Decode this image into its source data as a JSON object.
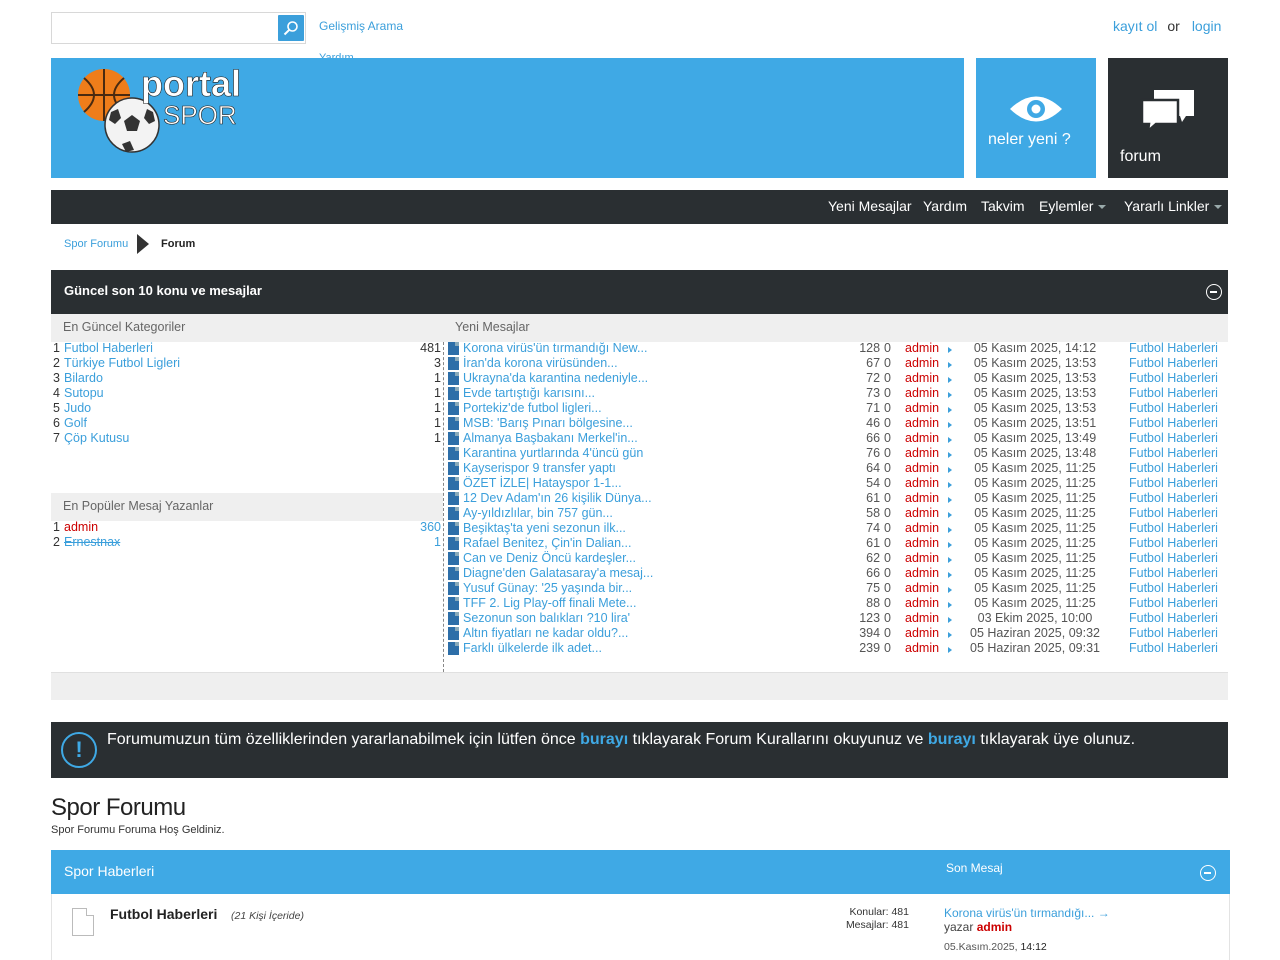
{
  "search": {
    "placeholder": "",
    "advanced_label": "Gelişmiş Arama",
    "help_label": "Yardım"
  },
  "auth": {
    "register": "kayıt ol",
    "or": "or",
    "login": "login"
  },
  "header": {
    "logo_text_1": "portal",
    "logo_text_2": "SPOR",
    "whats_new": "neler yeni ?",
    "forum": "forum"
  },
  "nav": {
    "items": [
      "Yeni Mesajlar",
      "Yardım",
      "Takvim",
      "Eylemler",
      "Yararlı Linkler"
    ]
  },
  "breadcrumb": {
    "home": "Spor Forumu",
    "current": "Forum"
  },
  "recent": {
    "title": "Güncel son 10 konu ve mesajlar",
    "categories_header": "En Güncel Kategoriler",
    "posters_header": "En Popüler Mesaj Yazanlar",
    "messages_header": "Yeni Mesajlar",
    "categories": [
      {
        "rank": "1",
        "name": "Futbol Haberleri",
        "count": "481"
      },
      {
        "rank": "2",
        "name": "Türkiye Futbol Ligleri",
        "count": "3"
      },
      {
        "rank": "3",
        "name": "Bilardo",
        "count": "1"
      },
      {
        "rank": "4",
        "name": "Sutopu",
        "count": "1"
      },
      {
        "rank": "5",
        "name": "Judo",
        "count": "1"
      },
      {
        "rank": "6",
        "name": "Golf",
        "count": "1"
      },
      {
        "rank": "7",
        "name": "Çöp Kutusu",
        "count": "1"
      }
    ],
    "posters": [
      {
        "rank": "1",
        "name": "admin",
        "count": "360"
      },
      {
        "rank": "2",
        "name": "Ernestnax",
        "count": "1"
      }
    ],
    "messages": [
      {
        "title": "Korona virüs'ün tırmandığı New...",
        "views": "128",
        "replies": "0",
        "user": "admin",
        "date": "05 Kasım 2025, 14:12",
        "forum": "Futbol Haberleri"
      },
      {
        "title": "İran'da korona virüsünden...",
        "views": "67",
        "replies": "0",
        "user": "admin",
        "date": "05 Kasım 2025, 13:53",
        "forum": "Futbol Haberleri"
      },
      {
        "title": "Ukrayna'da karantina nedeniyle...",
        "views": "72",
        "replies": "0",
        "user": "admin",
        "date": "05 Kasım 2025, 13:53",
        "forum": "Futbol Haberleri"
      },
      {
        "title": "Evde tartıştığı karısını...",
        "views": "73",
        "replies": "0",
        "user": "admin",
        "date": "05 Kasım 2025, 13:53",
        "forum": "Futbol Haberleri"
      },
      {
        "title": "Portekiz'de futbol ligleri...",
        "views": "71",
        "replies": "0",
        "user": "admin",
        "date": "05 Kasım 2025, 13:53",
        "forum": "Futbol Haberleri"
      },
      {
        "title": "MSB: 'Barış Pınarı bölgesine...",
        "views": "46",
        "replies": "0",
        "user": "admin",
        "date": "05 Kasım 2025, 13:51",
        "forum": "Futbol Haberleri"
      },
      {
        "title": "Almanya Başbakanı Merkel'in...",
        "views": "66",
        "replies": "0",
        "user": "admin",
        "date": "05 Kasım 2025, 13:49",
        "forum": "Futbol Haberleri"
      },
      {
        "title": "Karantina yurtlarında 4'üncü gün",
        "views": "76",
        "replies": "0",
        "user": "admin",
        "date": "05 Kasım 2025, 13:48",
        "forum": "Futbol Haberleri"
      },
      {
        "title": "Kayserispor 9 transfer yaptı",
        "views": "64",
        "replies": "0",
        "user": "admin",
        "date": "05 Kasım 2025, 11:25",
        "forum": "Futbol Haberleri"
      },
      {
        "title": "ÖZET İZLE| Hatayspor 1-1...",
        "views": "54",
        "replies": "0",
        "user": "admin",
        "date": "05 Kasım 2025, 11:25",
        "forum": "Futbol Haberleri"
      },
      {
        "title": "12 Dev Adam'ın 26 kişilik Dünya...",
        "views": "61",
        "replies": "0",
        "user": "admin",
        "date": "05 Kasım 2025, 11:25",
        "forum": "Futbol Haberleri"
      },
      {
        "title": "Ay-yıldızlılar, bin 757 gün...",
        "views": "58",
        "replies": "0",
        "user": "admin",
        "date": "05 Kasım 2025, 11:25",
        "forum": "Futbol Haberleri"
      },
      {
        "title": "Beşiktaş'ta yeni sezonun ilk...",
        "views": "74",
        "replies": "0",
        "user": "admin",
        "date": "05 Kasım 2025, 11:25",
        "forum": "Futbol Haberleri"
      },
      {
        "title": "Rafael Benitez, Çin'in Dalian...",
        "views": "61",
        "replies": "0",
        "user": "admin",
        "date": "05 Kasım 2025, 11:25",
        "forum": "Futbol Haberleri"
      },
      {
        "title": "Can ve Deniz Öncü kardeşler...",
        "views": "62",
        "replies": "0",
        "user": "admin",
        "date": "05 Kasım 2025, 11:25",
        "forum": "Futbol Haberleri"
      },
      {
        "title": "Diagne'den Galatasaray'a mesaj...",
        "views": "66",
        "replies": "0",
        "user": "admin",
        "date": "05 Kasım 2025, 11:25",
        "forum": "Futbol Haberleri"
      },
      {
        "title": "Yusuf Günay: '25 yaşında bir...",
        "views": "75",
        "replies": "0",
        "user": "admin",
        "date": "05 Kasım 2025, 11:25",
        "forum": "Futbol Haberleri"
      },
      {
        "title": "TFF 2. Lig Play-off finali Mete...",
        "views": "88",
        "replies": "0",
        "user": "admin",
        "date": "05 Kasım 2025, 11:25",
        "forum": "Futbol Haberleri"
      },
      {
        "title": "Sezonun son balıkları ?10 lira'",
        "views": "123",
        "replies": "0",
        "user": "admin",
        "date": "03 Ekim 2025, 10:00",
        "forum": "Futbol Haberleri"
      },
      {
        "title": "Altın fiyatları ne kadar oldu?...",
        "views": "394",
        "replies": "0",
        "user": "admin",
        "date": "05 Haziran 2025, 09:32",
        "forum": "Futbol Haberleri"
      },
      {
        "title": "Farklı ülkelerde ilk adet...",
        "views": "239",
        "replies": "0",
        "user": "admin",
        "date": "05 Haziran 2025, 09:31",
        "forum": "Futbol Haberleri"
      }
    ]
  },
  "notice": {
    "part1": "Forumumuzun tüm özelliklerinden yararlanabilmek için lütfen önce",
    "link1": "burayı",
    "part2": "tıklayarak Forum Kurallarını okuyunuz ve",
    "link2": "burayı",
    "part3": "tıklayarak üye olunuz."
  },
  "forum": {
    "title": "Spor Forumu",
    "description": "Spor Forumu Foruma Hoş Geldiniz."
  },
  "category": {
    "title": "Spor Haberleri",
    "last_post_header": "Son Mesaj",
    "forums": [
      {
        "name": "Futbol Haberleri",
        "viewing": "(21 Kişi İçeride)",
        "threads_label": "Konular:",
        "threads": "481",
        "posts_label": "Mesajlar:",
        "posts": "481",
        "last_post_title": "Korona virüs'ün tırmandığı...",
        "last_post_by_label": "yazar",
        "last_post_user": "admin",
        "last_post_date": "05.Kasım.2025,",
        "last_post_time": "14:12"
      }
    ]
  },
  "colors": {
    "accent": "#3fa9e5",
    "dark": "#2a2f32",
    "link": "#3b9fdb",
    "user": "#cc0000"
  }
}
